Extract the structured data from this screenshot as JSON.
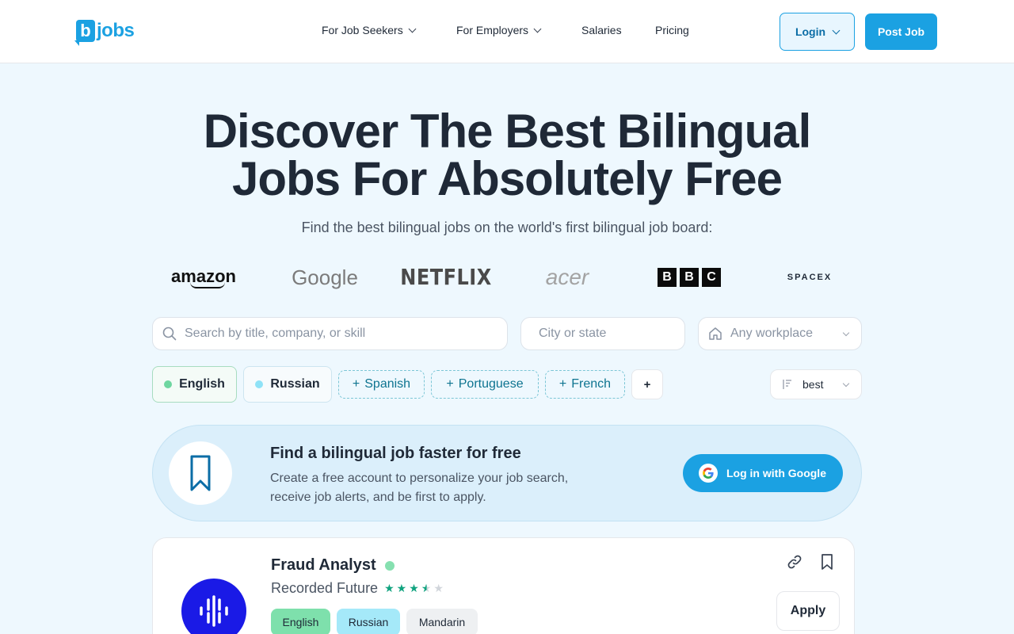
{
  "header": {
    "logo_letter": "b",
    "logo_text": "jobs",
    "nav": {
      "job_seekers": "For Job Seekers",
      "employers": "For Employers",
      "salaries": "Salaries",
      "pricing": "Pricing"
    },
    "login_label": "Login",
    "post_job_label": "Post Job"
  },
  "hero": {
    "title_line1": "Discover The Best Bilingual",
    "title_line2": "Jobs For Absolutely Free",
    "subtitle": "Find the best bilingual jobs on the world's first bilingual job board:"
  },
  "brands": {
    "amazon": "amazon",
    "google": "Google",
    "netflix": "NETFLIX",
    "acer": "acer",
    "bbc": [
      "B",
      "B",
      "C"
    ],
    "spacex": "SPACEX"
  },
  "search": {
    "query_placeholder": "Search by title, company, or skill",
    "city_placeholder": "City or state",
    "workplace_label": "Any workplace"
  },
  "languages": {
    "selected": [
      "English",
      "Russian"
    ],
    "suggested": [
      "Spanish",
      "Portuguese",
      "French"
    ],
    "plus_symbol": "+",
    "more_label": "+"
  },
  "sort": {
    "label": "best"
  },
  "banner": {
    "title": "Find a bilingual job faster for free",
    "text": "Create a free account to personalize your job search, receive job alerts, and be first to apply.",
    "google_button": "Log in with Google"
  },
  "job": {
    "title": "Fraud Analyst",
    "company": "Recorded Future",
    "rating": 3.5,
    "rating_max": 5,
    "tags": [
      "English",
      "Russian",
      "Mandarin"
    ],
    "apply_label": "Apply"
  },
  "colors": {
    "accent": "#1ba1e2",
    "background": "#eef8fe",
    "english_green": "#7ee0ac",
    "russian_cyan": "#a5e9f9",
    "company_logo_blue": "#1a1ae6"
  }
}
